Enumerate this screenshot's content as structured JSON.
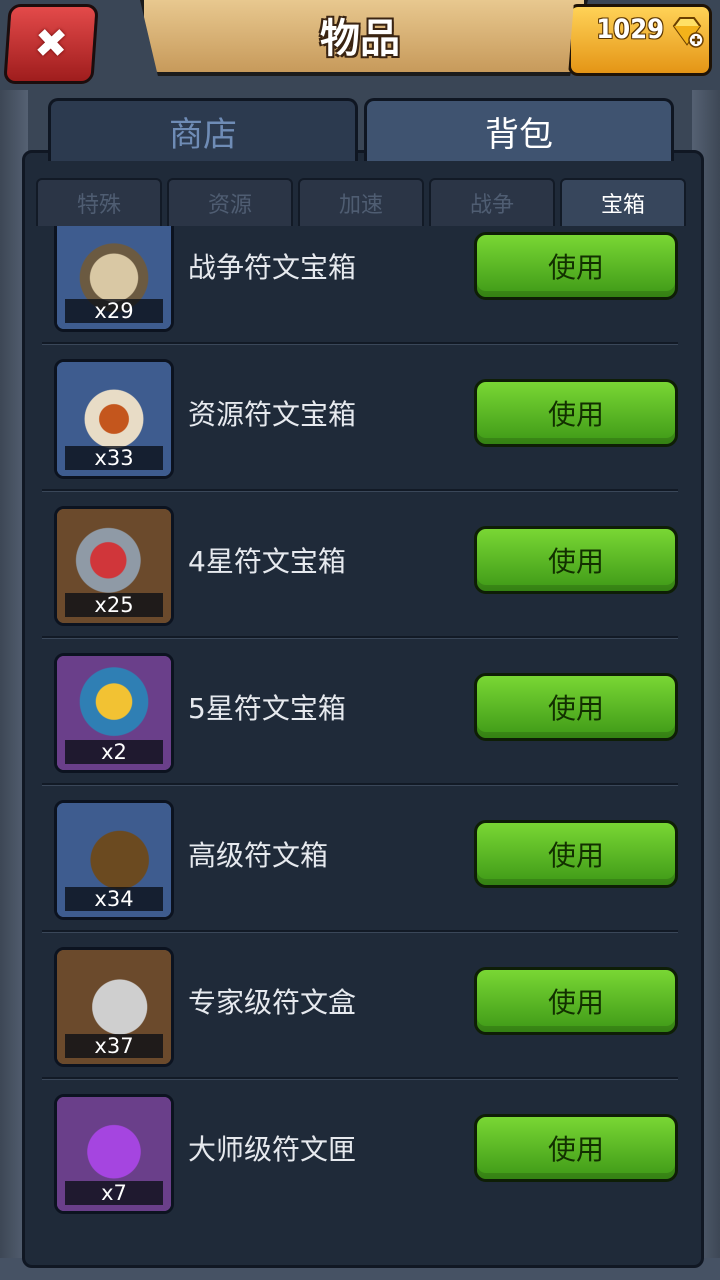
{
  "header": {
    "title": "物品",
    "close_icon": "close-x-icon",
    "gems": "1029",
    "gem_icon": "diamond-plus-icon"
  },
  "main_tabs": [
    {
      "label": "商店",
      "active": false
    },
    {
      "label": "背包",
      "active": true
    }
  ],
  "sub_tabs": [
    {
      "label": "特殊",
      "active": false
    },
    {
      "label": "资源",
      "active": false
    },
    {
      "label": "加速",
      "active": false
    },
    {
      "label": "战争",
      "active": false
    },
    {
      "label": "宝箱",
      "active": true
    }
  ],
  "items": [
    {
      "name": "战争符文宝箱",
      "qty": "x29",
      "button": "使用",
      "icon": "war-rune-chest-icon"
    },
    {
      "name": "资源符文宝箱",
      "qty": "x33",
      "button": "使用",
      "icon": "resource-rune-chest-icon"
    },
    {
      "name": "4星符文宝箱",
      "qty": "x25",
      "button": "使用",
      "icon": "four-star-rune-chest-icon"
    },
    {
      "name": "5星符文宝箱",
      "qty": "x2",
      "button": "使用",
      "icon": "five-star-rune-chest-icon"
    },
    {
      "name": "高级符文箱",
      "qty": "x34",
      "button": "使用",
      "icon": "advanced-rune-box-icon"
    },
    {
      "name": "专家级符文盒",
      "qty": "x37",
      "button": "使用",
      "icon": "expert-rune-box-icon"
    },
    {
      "name": "大师级符文匣",
      "qty": "x7",
      "button": "使用",
      "icon": "master-rune-case-icon"
    }
  ]
}
